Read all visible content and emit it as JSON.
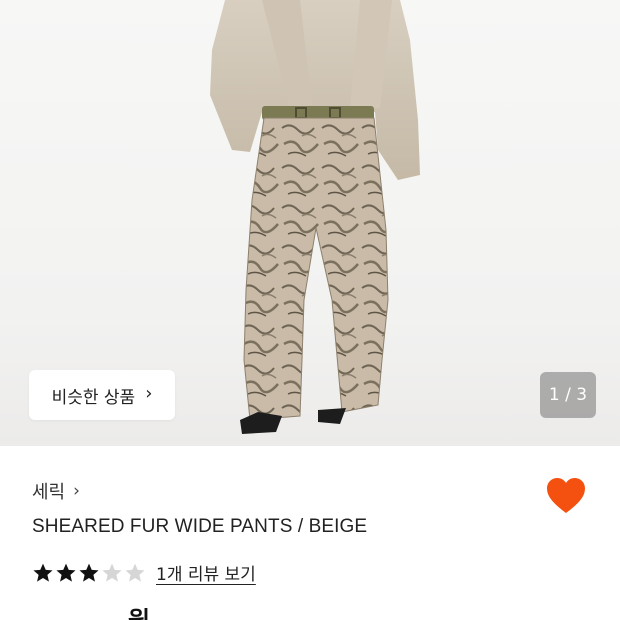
{
  "gallery": {
    "similar_products_label": "비슷한 상품",
    "page_counter": "1 / 3",
    "current_image": 1,
    "total_images": 3
  },
  "product": {
    "brand": "세릭",
    "name": "SHEARED FUR WIDE PANTS / BEIGE",
    "rating": 3,
    "rating_max": 5,
    "review_link": "1개 리뷰 보기",
    "price_partial": "원",
    "wishlisted": true
  },
  "colors": {
    "heart": "#f4500f",
    "star_filled": "#111111",
    "star_empty": "#d6d6d6"
  },
  "icons": {
    "brand_chevron": "chevron-right-icon",
    "similar_chevron": "chevron-right-icon",
    "wishlist": "heart-icon",
    "rating": "star-icon"
  }
}
